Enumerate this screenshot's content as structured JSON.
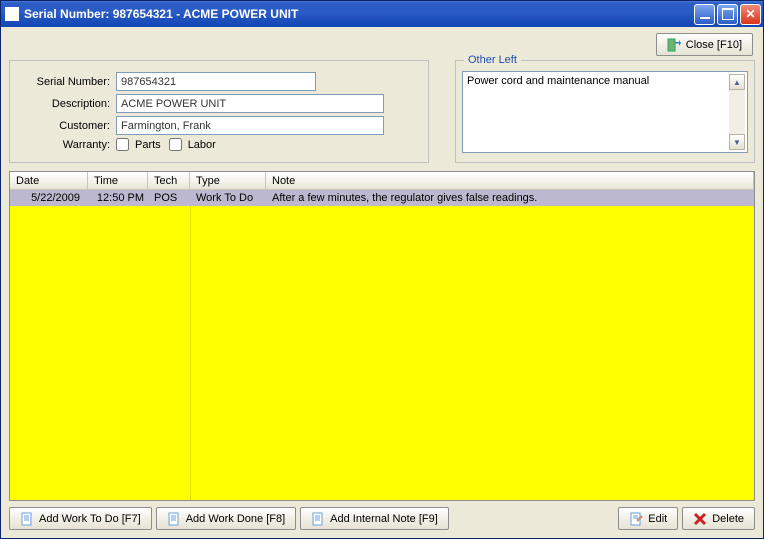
{
  "window": {
    "title": "Serial Number: 987654321 - ACME POWER UNIT"
  },
  "top": {
    "close_label": "Close [F10]"
  },
  "form": {
    "serial_label": "Serial Number:",
    "serial_value": "987654321",
    "description_label": "Description:",
    "description_value": "ACME POWER UNIT",
    "customer_label": "Customer:",
    "customer_value": "Farmington, Frank",
    "warranty_label": "Warranty:",
    "parts_label": "Parts",
    "labor_label": "Labor"
  },
  "other_left": {
    "title": "Other Left",
    "text": "Power cord and maintenance manual"
  },
  "grid": {
    "headers": {
      "date": "Date",
      "time": "Time",
      "tech": "Tech",
      "type": "Type",
      "note": "Note"
    },
    "rows": [
      {
        "date": "5/22/2009",
        "time": "12:50 PM",
        "tech": "POS",
        "type": "Work To Do",
        "note": "After a few minutes, the regulator gives false readings."
      }
    ]
  },
  "buttons": {
    "add_wtd": "Add Work To Do [F7]",
    "add_wd": "Add Work Done [F8]",
    "add_in": "Add Internal Note [F9]",
    "edit": "Edit",
    "delete": "Delete"
  }
}
